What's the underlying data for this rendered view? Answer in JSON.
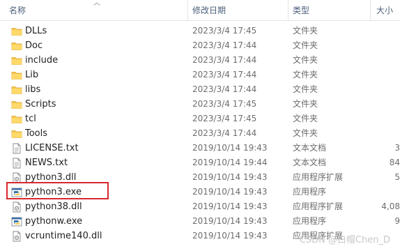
{
  "columns": {
    "name": "名称",
    "modified": "修改日期",
    "type": "类型",
    "size": "大小"
  },
  "files": [
    {
      "name": "DLLs",
      "modified": "2023/3/4 17:45",
      "type": "文件夹",
      "size": "",
      "icon": "folder-icon"
    },
    {
      "name": "Doc",
      "modified": "2023/3/4 17:44",
      "type": "文件夹",
      "size": "",
      "icon": "folder-icon"
    },
    {
      "name": "include",
      "modified": "2023/3/4 17:44",
      "type": "文件夹",
      "size": "",
      "icon": "folder-icon"
    },
    {
      "name": "Lib",
      "modified": "2023/3/4 17:44",
      "type": "文件夹",
      "size": "",
      "icon": "folder-icon"
    },
    {
      "name": "libs",
      "modified": "2023/3/4 17:44",
      "type": "文件夹",
      "size": "",
      "icon": "folder-icon"
    },
    {
      "name": "Scripts",
      "modified": "2023/3/4 17:45",
      "type": "文件夹",
      "size": "",
      "icon": "folder-icon"
    },
    {
      "name": "tcl",
      "modified": "2023/3/4 17:45",
      "type": "文件夹",
      "size": "",
      "icon": "folder-icon"
    },
    {
      "name": "Tools",
      "modified": "2023/3/4 17:44",
      "type": "文件夹",
      "size": "",
      "icon": "folder-icon"
    },
    {
      "name": "LICENSE.txt",
      "modified": "2019/10/14 19:43",
      "type": "文本文档",
      "size": "3",
      "icon": "text-file-icon"
    },
    {
      "name": "NEWS.txt",
      "modified": "2019/10/14 19:44",
      "type": "文本文档",
      "size": "84",
      "icon": "text-file-icon"
    },
    {
      "name": "python3.dll",
      "modified": "2019/10/14 19:43",
      "type": "应用程序扩展",
      "size": "5",
      "icon": "dll-file-icon"
    },
    {
      "name": "python3.exe",
      "modified": "2019/10/14 19:43",
      "type": "应用程序",
      "size": "",
      "icon": "python-exe-icon"
    },
    {
      "name": "python38.dll",
      "modified": "2019/10/14 19:43",
      "type": "应用程序扩展",
      "size": "4,08",
      "icon": "dll-file-icon"
    },
    {
      "name": "pythonw.exe",
      "modified": "2019/10/14 19:43",
      "type": "应用程序",
      "size": "9",
      "icon": "python-exe-icon"
    },
    {
      "name": "vcruntime140.dll",
      "modified": "2019/10/14 19:43",
      "type": "应用程序扩展",
      "size": "",
      "icon": "dll-file-icon"
    }
  ],
  "watermark": "CSDN @白帽Chen_D",
  "colors": {
    "highlight": "#d9272e",
    "folder": "#f4c84e"
  }
}
